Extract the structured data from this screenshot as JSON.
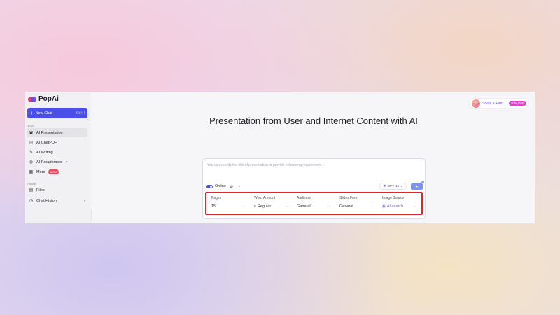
{
  "app": {
    "name": "PopAi"
  },
  "sidebar": {
    "new_chat": {
      "label": "New Chat",
      "shortcut": "Ctrl+I"
    },
    "tools_label": "Tools",
    "tools": [
      {
        "label": "AI Presentation",
        "icon": "presentation-icon",
        "active": true
      },
      {
        "label": "AI ChatPDF",
        "icon": "pdf-icon"
      },
      {
        "label": "AI Writing",
        "icon": "pen-icon"
      },
      {
        "label": "AI Paraphraser",
        "icon": "paraphrase-icon"
      },
      {
        "label": "More",
        "icon": "grid-icon",
        "badge": "NEW"
      }
    ],
    "assets_label": "Assets",
    "assets": [
      {
        "label": "Files",
        "icon": "files-icon"
      },
      {
        "label": "Chat History",
        "icon": "history-icon"
      }
    ]
  },
  "header": {
    "share": {
      "label": "Share & Earn",
      "badge": "20% OFF"
    }
  },
  "main": {
    "title": "Presentation from User and Internet Content with AI",
    "composer": {
      "placeholder": "You can specify the title of presentation or provide enhancing requirement.",
      "online_label": "Online",
      "model": "GPT-4o"
    },
    "options": [
      {
        "label": "Pages",
        "value": "15"
      },
      {
        "label": "Word Amount",
        "value": "Regular"
      },
      {
        "label": "Audience",
        "value": "General"
      },
      {
        "label": "Slides Form",
        "value": "General"
      },
      {
        "label": "Image Source",
        "value": "AI-search"
      }
    ]
  },
  "colors": {
    "accent": "#4b4ee8",
    "highlight_border": "#d8282e"
  }
}
